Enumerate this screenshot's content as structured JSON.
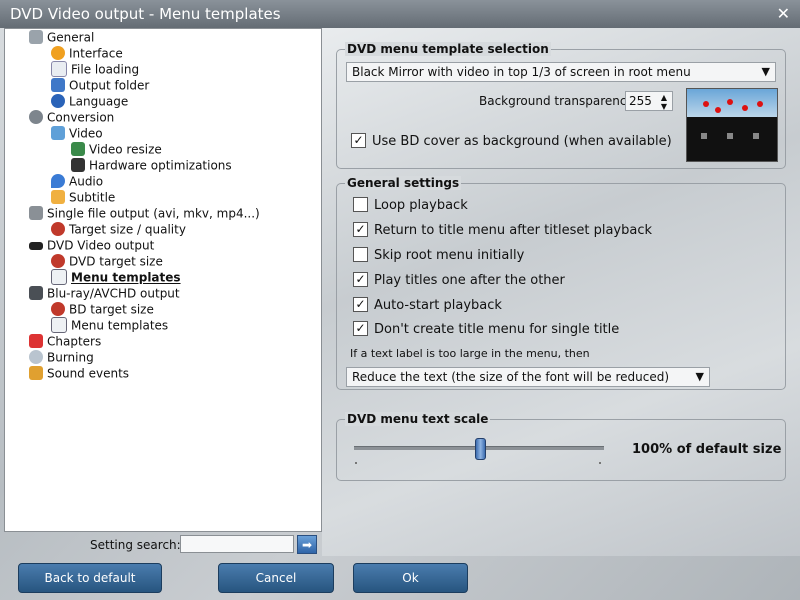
{
  "window": {
    "title": "DVD Video output - Menu templates",
    "close_glyph": "✕"
  },
  "tree": [
    {
      "label": "General",
      "icon": "wrench-icon"
    },
    {
      "label": "Interface",
      "icon": "interface-icon"
    },
    {
      "label": "File loading",
      "icon": "file-icon"
    },
    {
      "label": "Output folder",
      "icon": "folder-icon"
    },
    {
      "label": "Language",
      "icon": "globe-icon"
    },
    {
      "label": "Conversion",
      "icon": "gear-icon"
    },
    {
      "label": "Video",
      "icon": "video-icon"
    },
    {
      "label": "Video resize",
      "icon": "resize-icon"
    },
    {
      "label": "Hardware optimizations",
      "icon": "chip-icon"
    },
    {
      "label": "Audio",
      "icon": "music-note-icon"
    },
    {
      "label": "Subtitle",
      "icon": "subtitle-icon"
    },
    {
      "label": "Single file output (avi, mkv, mp4...)",
      "icon": "film-icon"
    },
    {
      "label": "Target size / quality",
      "icon": "target-icon"
    },
    {
      "label": "DVD Video output",
      "icon": "dvd-icon"
    },
    {
      "label": "DVD target size",
      "icon": "target-icon"
    },
    {
      "label": "Menu templates",
      "icon": "menu-list-icon"
    },
    {
      "label": "Blu-ray/AVCHD output",
      "icon": "hd-icon"
    },
    {
      "label": "BD target size",
      "icon": "target-icon"
    },
    {
      "label": "Menu templates",
      "icon": "menu-list-icon"
    },
    {
      "label": "Chapters",
      "icon": "flag-icon"
    },
    {
      "label": "Burning",
      "icon": "disc-icon"
    },
    {
      "label": "Sound events",
      "icon": "speaker-icon"
    }
  ],
  "search": {
    "label": "Setting search:",
    "value": "",
    "button_glyph": "➡"
  },
  "dvd_template": {
    "group_title": "DVD menu template selection",
    "selected": "Black Mirror with video in top 1/3 of screen in root menu",
    "transparency_label": "Background transparency:",
    "transparency_value": "255",
    "bd_cover_label": "Use BD cover as background (when available)",
    "bd_cover_checked": true
  },
  "general_settings": {
    "group_title": "General settings",
    "options": [
      {
        "label": "Loop playback",
        "checked": false
      },
      {
        "label": "Return to title menu after titleset playback",
        "checked": true
      },
      {
        "label": "Skip root menu initially",
        "checked": false
      },
      {
        "label": "Play titles one after the other",
        "checked": true
      },
      {
        "label": "Auto-start playback",
        "checked": true
      },
      {
        "label": "Don't create title menu for single title",
        "checked": true
      }
    ],
    "label_too_large_text": "If a text label is too large in the menu, then",
    "reduce_option": "Reduce the text (the size of the font will be reduced)"
  },
  "text_scale": {
    "group_title": "DVD menu text scale",
    "value_label": "100% of default size",
    "level_fraction": 0.5
  },
  "buttons": {
    "back_to_default": "Back to default",
    "cancel": "Cancel",
    "ok": "Ok"
  },
  "colors": {
    "accent": "#2f64a8",
    "button": "#3a6a99"
  }
}
